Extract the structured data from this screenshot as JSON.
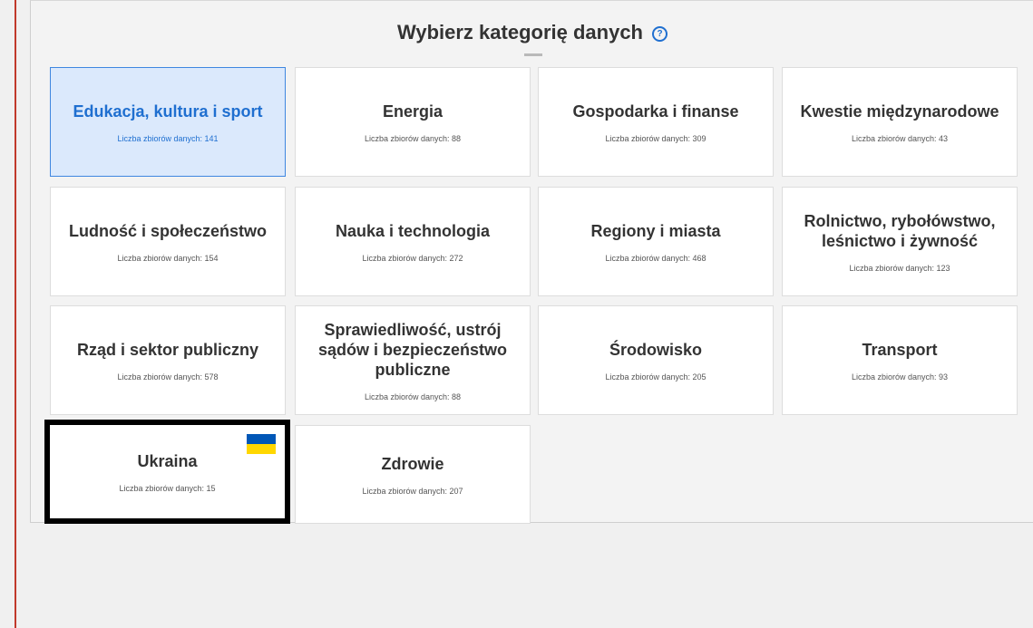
{
  "header": {
    "title": "Wybierz kategorię danych",
    "help_icon": "question-circle-icon"
  },
  "colors": {
    "accent": "#1f6fd0",
    "active_bg": "#dbe9fc",
    "flag_blue": "#0057b7",
    "flag_yellow": "#ffd700",
    "left_edge": "#c0392b"
  },
  "categories": [
    {
      "title": "Edukacja, kultura i sport",
      "count": "Liczba zbiorów danych: 141",
      "state": "active"
    },
    {
      "title": "Energia",
      "count": "Liczba zbiorów danych: 88"
    },
    {
      "title": "Gospodarka i finanse",
      "count": "Liczba zbiorów danych: 309"
    },
    {
      "title": "Kwestie międzynarodowe",
      "count": "Liczba zbiorów danych: 43"
    },
    {
      "title": "Ludność i społeczeństwo",
      "count": "Liczba zbiorów danych: 154"
    },
    {
      "title": "Nauka i technologia",
      "count": "Liczba zbiorów danych: 272"
    },
    {
      "title": "Regiony i miasta",
      "count": "Liczba zbiorów danych: 468"
    },
    {
      "title": "Rolnictwo, rybołówstwo, leśnictwo i żywność",
      "count": "Liczba zbiorów danych: 123"
    },
    {
      "title": "Rząd i sektor publiczny",
      "count": "Liczba zbiorów danych: 578"
    },
    {
      "title": "Sprawiedliwość, ustrój sądów i bezpieczeństwo publiczne",
      "count": "Liczba zbiorów danych: 88"
    },
    {
      "title": "Środowisko",
      "count": "Liczba zbiorów danych: 205"
    },
    {
      "title": "Transport",
      "count": "Liczba zbiorów danych: 93"
    },
    {
      "title": "Ukraina",
      "count": "Liczba zbiorów danych: 15",
      "state": "outlined",
      "icon": "ukraine-flag-icon"
    },
    {
      "title": "Zdrowie",
      "count": "Liczba zbiorów danych: 207"
    }
  ]
}
